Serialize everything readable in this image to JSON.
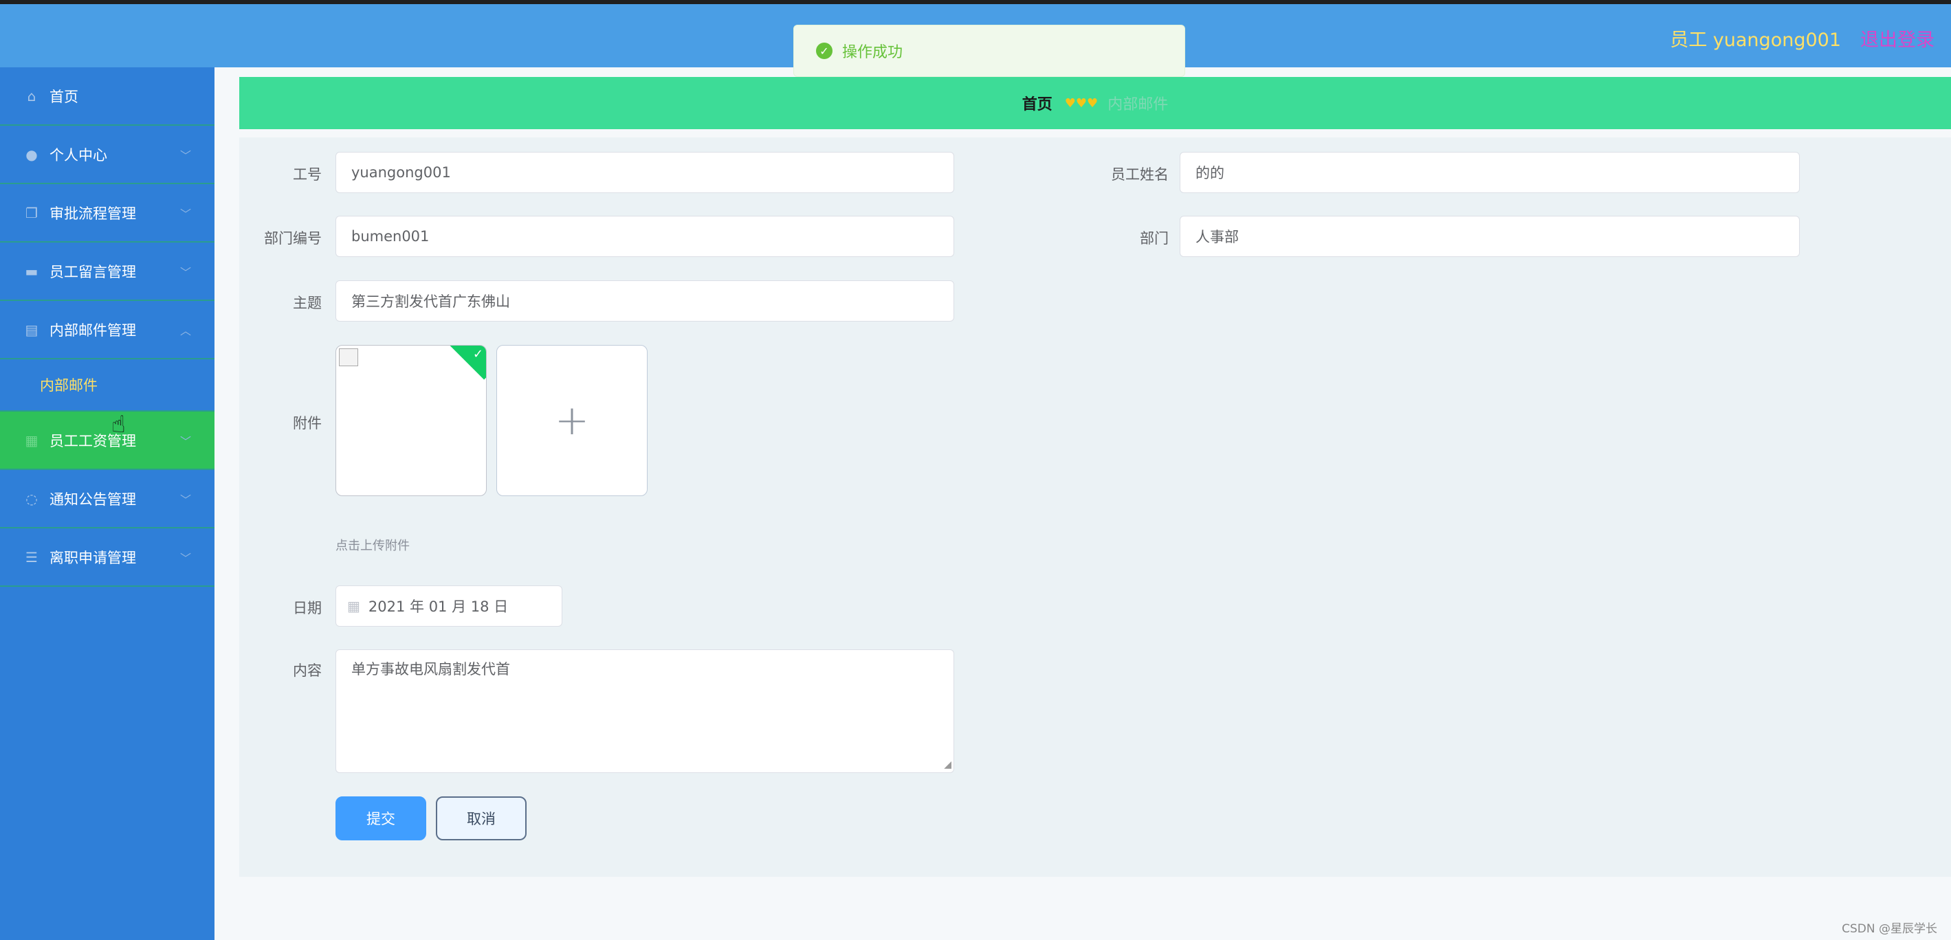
{
  "header": {
    "user_label": "员工 yuangong001",
    "logout_label": "退出登录"
  },
  "toast": {
    "message": "操作成功"
  },
  "sidebar": {
    "items": [
      {
        "label": "首页",
        "icon": "home-icon"
      },
      {
        "label": "个人中心",
        "icon": "user-icon"
      },
      {
        "label": "审批流程管理",
        "icon": "copy-icon"
      },
      {
        "label": "员工留言管理",
        "icon": "ticket-icon"
      },
      {
        "label": "内部邮件管理",
        "icon": "clipboard-icon"
      },
      {
        "label": "员工工资管理",
        "icon": "money-icon"
      },
      {
        "label": "通知公告管理",
        "icon": "bell-icon"
      },
      {
        "label": "离职申请管理",
        "icon": "list-icon"
      }
    ],
    "submenu": {
      "label": "内部邮件"
    }
  },
  "breadcrumb": {
    "home": "首页",
    "hearts": "♥♥♥",
    "current": "内部邮件"
  },
  "form": {
    "employee_id_label": "工号",
    "employee_id_value": "yuangong001",
    "employee_name_label": "员工姓名",
    "employee_name_value": "的的",
    "dept_code_label": "部门编号",
    "dept_code_value": "bumen001",
    "dept_label": "部门",
    "dept_value": "人事部",
    "subject_label": "主题",
    "subject_value": "第三方割发代首广东佛山",
    "attachment_label": "附件",
    "attachment_tip": "点击上传附件",
    "date_label": "日期",
    "date_value": "2021 年 01 月 18 日",
    "content_label": "内容",
    "content_value": "单方事故电风扇割发代首",
    "submit_label": "提交",
    "cancel_label": "取消"
  },
  "watermark": "CSDN @星辰学长",
  "colors": {
    "header_bg": "#4a9ee5",
    "sidebar_bg": "#2f7fd8",
    "active_menu": "#2ec15a",
    "breadcrumb_bg": "#3ddc97",
    "primary_button": "#409eff",
    "toast_success": "#67c23a"
  }
}
